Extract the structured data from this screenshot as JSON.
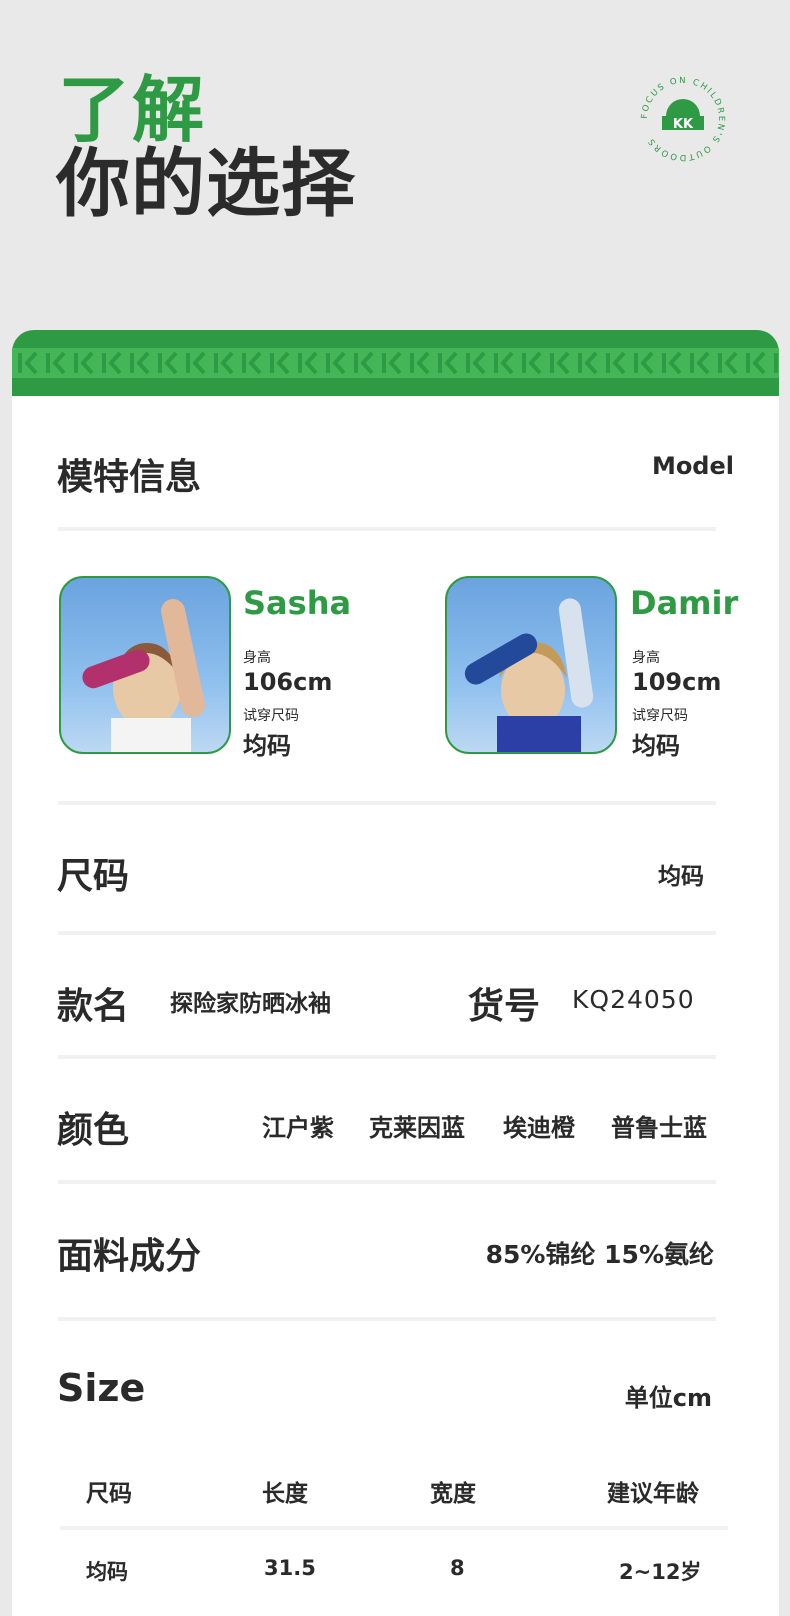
{
  "hero": {
    "line1": "了解",
    "line2": "你的选择"
  },
  "logo": {
    "mark": "KK",
    "ring_text": "FOCUS ON CHILDREN'S OUTDOORS"
  },
  "colors": {
    "brand_green": "#2f9a44",
    "band_light": "#44b657"
  },
  "model_section": {
    "title": "模特信息",
    "title_en": "Model",
    "models": [
      {
        "name": "Sasha",
        "height_label": "身高",
        "height": "106cm",
        "size_label": "试穿尺码",
        "size": "均码"
      },
      {
        "name": "Damir",
        "height_label": "身高",
        "height": "109cm",
        "size_label": "试穿尺码",
        "size": "均码"
      }
    ]
  },
  "size_row": {
    "title": "尺码",
    "value": "均码"
  },
  "style_row": {
    "title": "款名",
    "value": "探险家防晒冰袖",
    "sku_title": "货号",
    "sku": "KQ24050"
  },
  "color_row": {
    "title": "颜色",
    "options": [
      "江户紫",
      "克莱因蓝",
      "埃迪橙",
      "普鲁士蓝"
    ]
  },
  "fabric_row": {
    "title": "面料成分",
    "value": "85%锦纶 15%氨纶"
  },
  "size_table": {
    "title": "Size",
    "unit": "单位cm",
    "headers": [
      "尺码",
      "长度",
      "宽度",
      "建议年龄"
    ],
    "rows": [
      [
        "均码",
        "31.5",
        "8",
        "2~12岁"
      ]
    ]
  }
}
